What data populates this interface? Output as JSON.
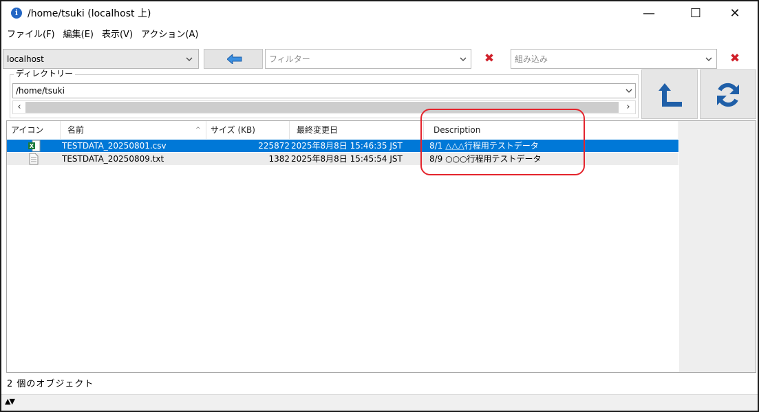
{
  "window": {
    "app_icon_glyph": "i",
    "title": "/home/tsuki (localhost 上)",
    "minimize": "—",
    "maximize": "☐",
    "close": "✕"
  },
  "menu": [
    "ファイル(F)",
    "編集(E)",
    "表示(V)",
    "アクション(A)"
  ],
  "toolbar": {
    "host": "localhost",
    "filter_placeholder": "フィルター",
    "builtin_placeholder": "組み込み",
    "clear_glyph": "✖"
  },
  "directory": {
    "legend": "ディレクトリー",
    "path": "/home/tsuki"
  },
  "table": {
    "columns": [
      "アイコン",
      "名前",
      "サイズ (KB)",
      "最終変更日",
      "Description"
    ],
    "rows": [
      {
        "name": "TESTDATA_20250801.csv",
        "size": "225872",
        "modified": "2025年8月8日 15:46:35 JST",
        "description": "8/1 △△△行程用テストデータ",
        "icon": "excel-csv-icon"
      },
      {
        "name": "TESTDATA_20250809.txt",
        "size": "1382",
        "modified": "2025年8月8日 15:45:54 JST",
        "description": "8/9 ○○○行程用テストデータ",
        "icon": "text-file-icon"
      }
    ]
  },
  "status": {
    "text": "2 個のオブジェクト",
    "toggle": "▲▼"
  },
  "colors": {
    "selection": "#0078d7",
    "annotation": "#e4242c",
    "accent_blue": "#1f5fa8",
    "clear_red": "#d0202a"
  }
}
